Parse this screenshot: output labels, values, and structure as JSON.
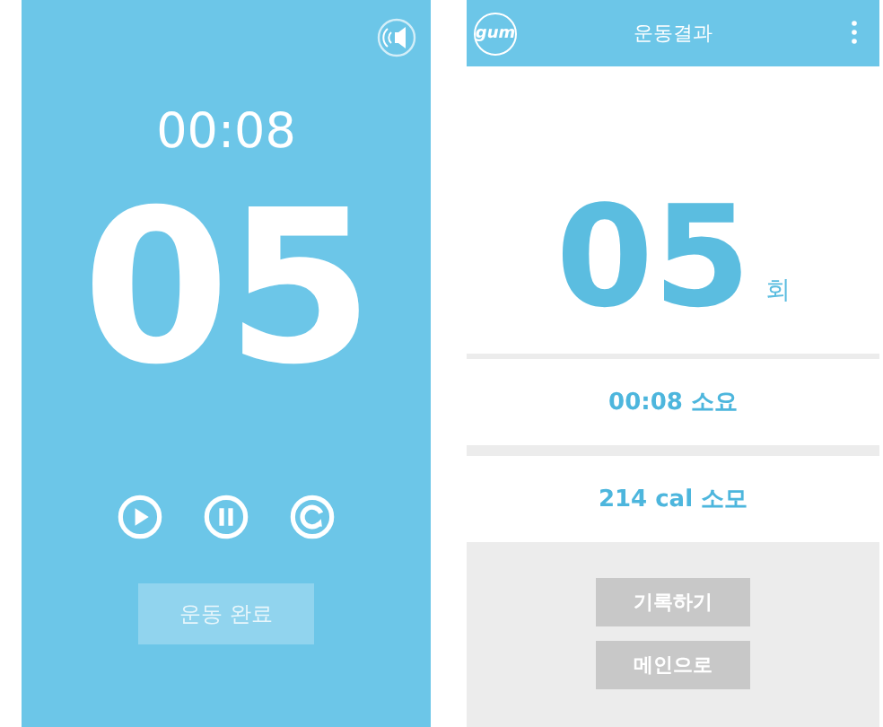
{
  "workout_screen": {
    "timer": "00:08",
    "count": "05",
    "controls": [
      {
        "kind": "play"
      },
      {
        "kind": "pause"
      },
      {
        "kind": "restart"
      }
    ],
    "finish_button": "운동 완료"
  },
  "result_screen": {
    "logo": "gum",
    "title": "운동결과",
    "count": "05",
    "count_unit": "회",
    "duration": "00:08 소요",
    "calories": "214 cal 소모",
    "buttons": [
      "기록하기",
      "메인으로"
    ]
  }
}
